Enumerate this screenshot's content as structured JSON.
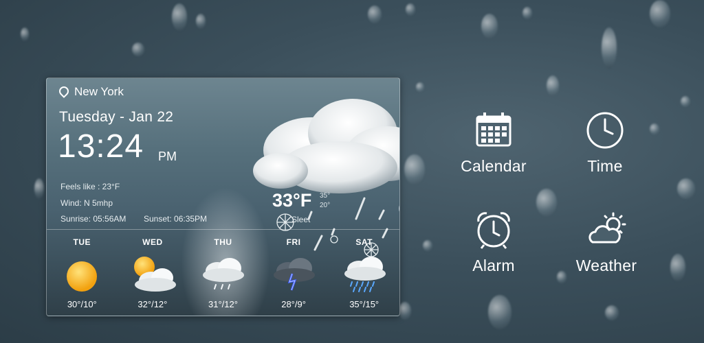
{
  "widget": {
    "location": "New York",
    "date": "Tuesday - Jan 22",
    "time": "13:24",
    "ampm": "PM",
    "feels_like": "Feels like : 23°F",
    "wind": "Wind: N 5mhp",
    "sunrise": "Sunrise: 05:56AM",
    "sunset": "Sunset: 06:35PM",
    "current_temp": "33°F",
    "high": "35°",
    "low": "20°",
    "condition": "Sleet",
    "forecast": [
      {
        "day": "TUE",
        "temps": "30°/10°",
        "icon": "sunny-icon"
      },
      {
        "day": "WED",
        "temps": "32°/12°",
        "icon": "partly-cloudy-icon"
      },
      {
        "day": "THU",
        "temps": "31°/12°",
        "icon": "rain-cloud-icon"
      },
      {
        "day": "FRI",
        "temps": "28°/9°",
        "icon": "thunderstorm-icon"
      },
      {
        "day": "SAT",
        "temps": "35°/15°",
        "icon": "heavy-rain-icon"
      }
    ]
  },
  "apps": [
    {
      "label": "Calendar",
      "icon": "calendar-icon"
    },
    {
      "label": "Time",
      "icon": "clock-icon"
    },
    {
      "label": "Alarm",
      "icon": "alarm-clock-icon"
    },
    {
      "label": "Weather",
      "icon": "weather-icon"
    }
  ],
  "colors": {
    "sun": "#f6b21b",
    "lightning": "#3b5bff",
    "rain": "#5aa8ff"
  }
}
